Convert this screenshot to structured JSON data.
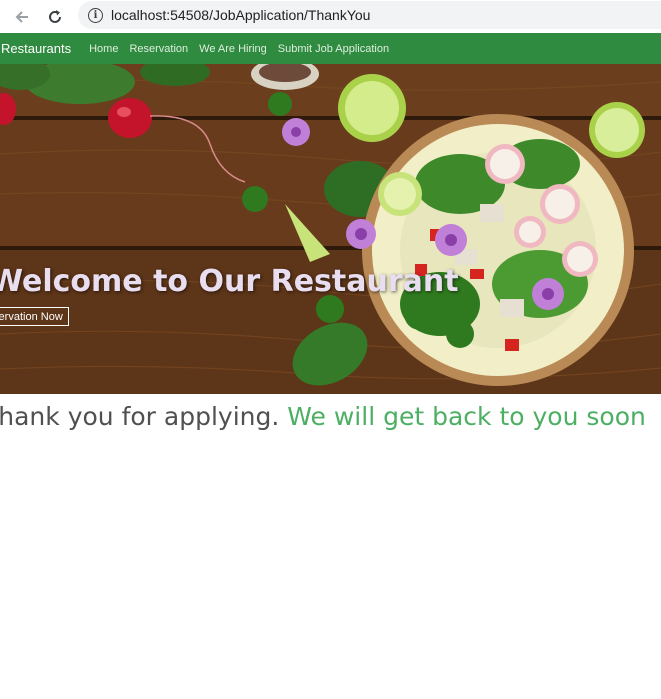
{
  "browser": {
    "back_icon": "arrow-left-icon",
    "reload_icon": "reload-icon",
    "info_icon": "info-icon",
    "url": "localhost:54508/JobApplication/ThankYou"
  },
  "navbar": {
    "brand": "Restaurants",
    "links": [
      "Home",
      "Reservation",
      "We Are Hiring",
      "Submit Job Application"
    ],
    "color": "#2e8b3f"
  },
  "hero": {
    "title": "Welcome to Our Restaurant",
    "button": "Reservation Now"
  },
  "message": {
    "part1": "Thank you for applying.",
    "part2": "We will get back to you soon",
    "accent": "#4caf63"
  }
}
